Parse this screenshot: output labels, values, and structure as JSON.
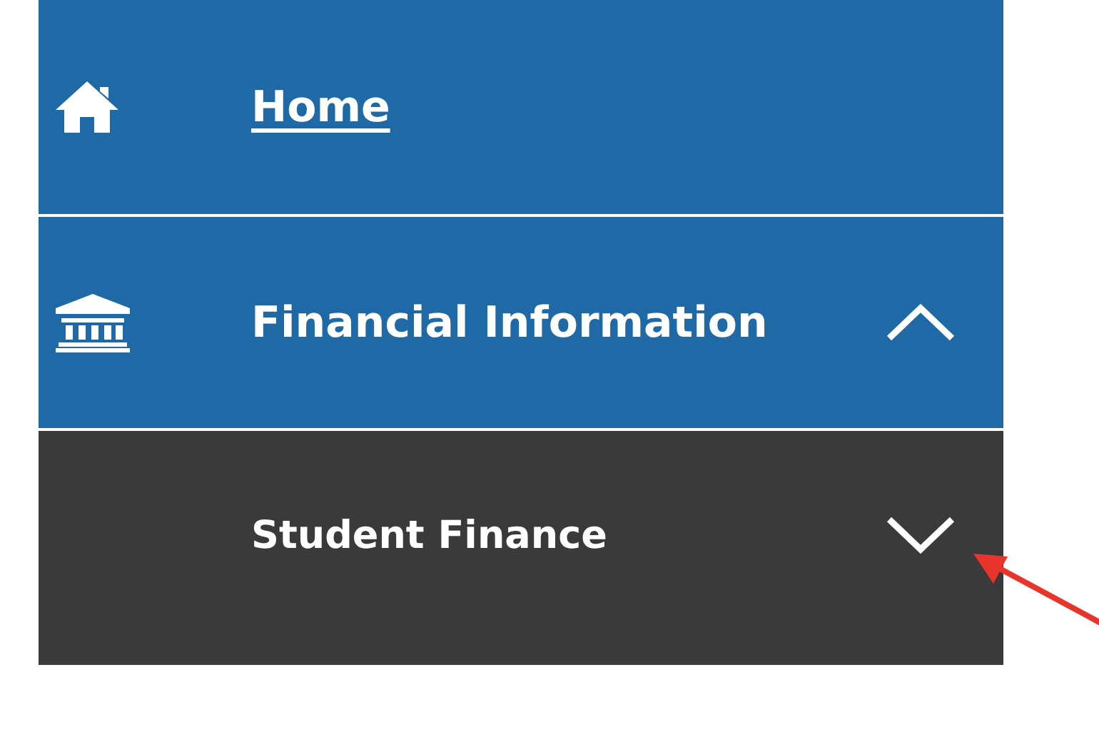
{
  "nav": {
    "items": [
      {
        "label": "Home",
        "kind": "link",
        "underlined": true
      },
      {
        "label": "Financial Information",
        "kind": "group",
        "expanded": true,
        "children": [
          {
            "label": "Student Finance",
            "kind": "group",
            "expanded": false
          }
        ]
      }
    ]
  }
}
